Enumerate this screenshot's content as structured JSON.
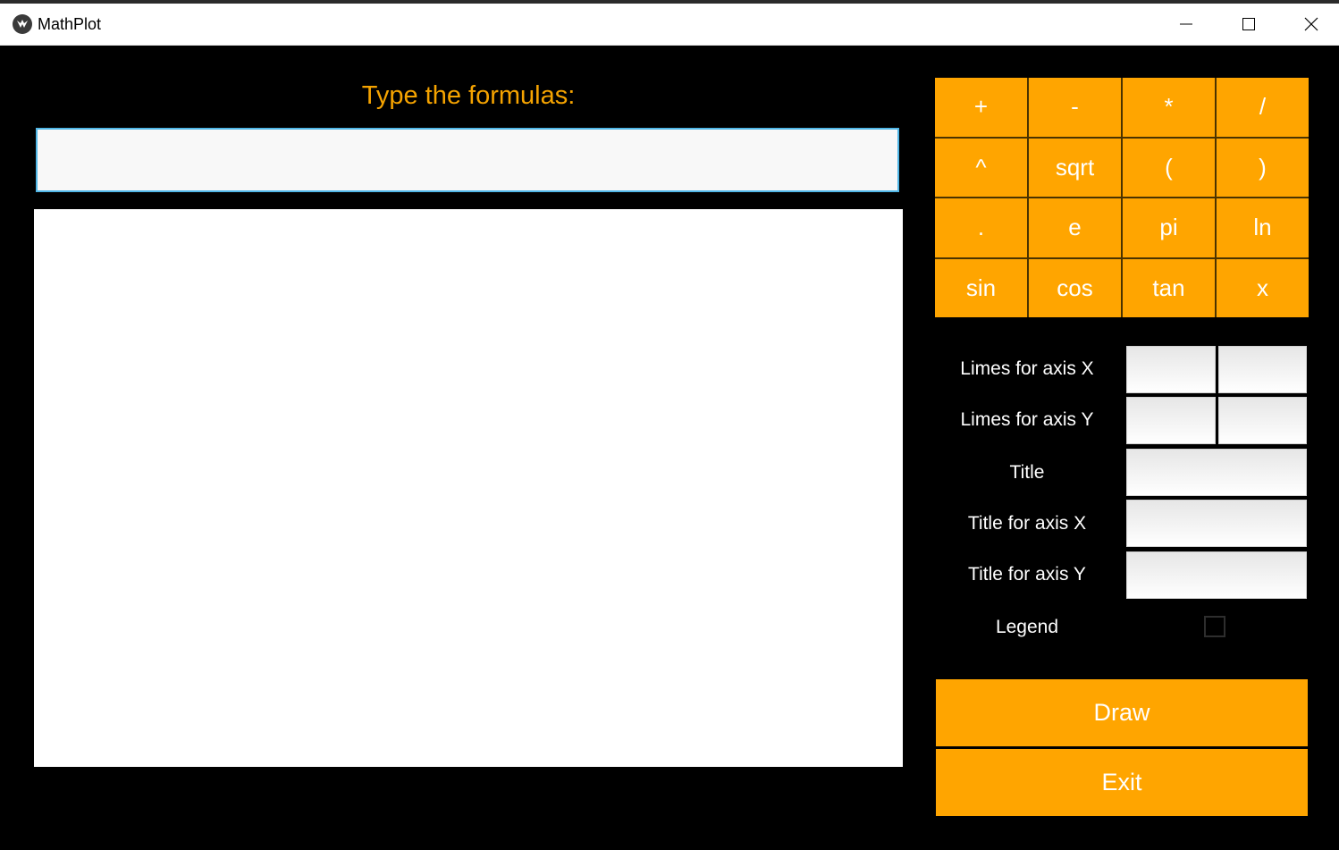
{
  "window": {
    "title": "MathPlot",
    "accent_color": "#ffa500",
    "controls": [
      "minimize-icon",
      "maximize-icon",
      "close-icon"
    ]
  },
  "formula": {
    "heading": "Type the formulas:",
    "value": "",
    "placeholder": ""
  },
  "keypad": {
    "keys": [
      "+",
      "-",
      "*",
      "/",
      "^",
      "sqrt",
      "(",
      ")",
      ".",
      "e",
      "pi",
      "ln",
      "sin",
      "cos",
      "tan",
      "x"
    ]
  },
  "options": {
    "limits_x_label": "Limes for axis X",
    "limits_y_label": "Limes for axis Y",
    "title_label": "Title",
    "title_x_label": "Title for axis X",
    "title_y_label": "Title for axis Y",
    "legend_label": "Legend",
    "legend_checked": false
  },
  "actions": {
    "draw_label": "Draw",
    "exit_label": "Exit"
  }
}
